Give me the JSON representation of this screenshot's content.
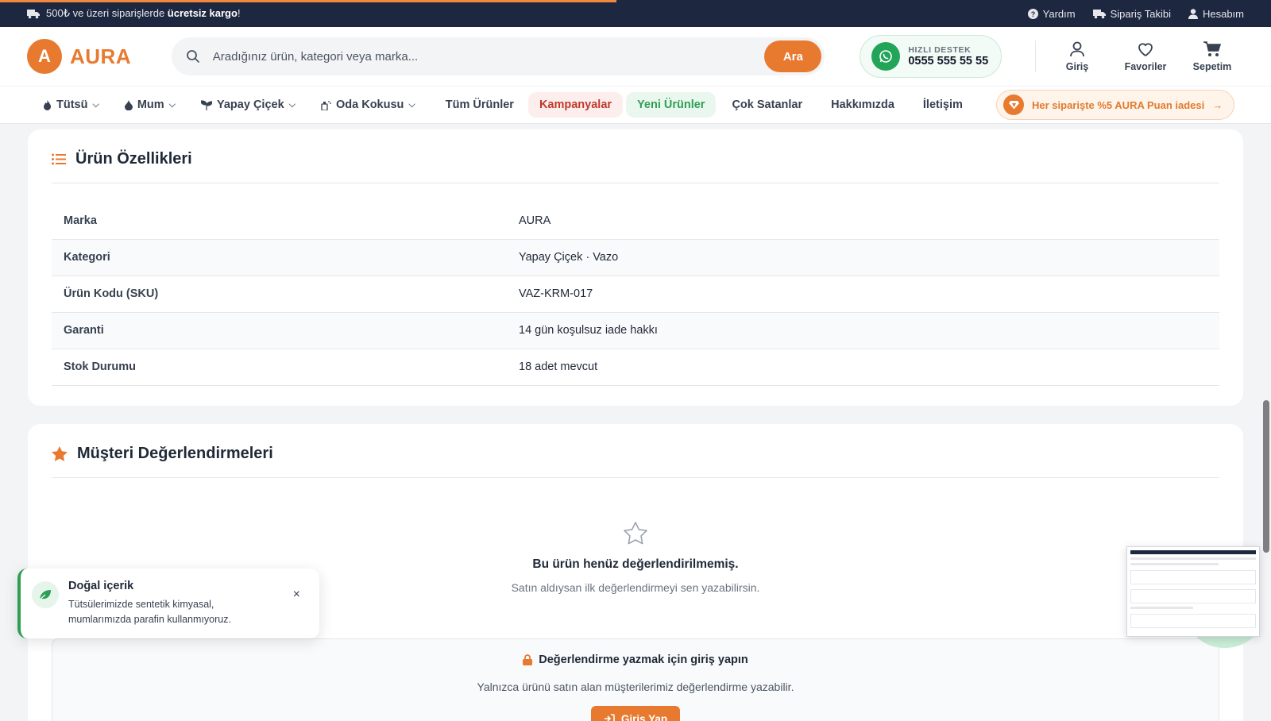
{
  "topbar": {
    "promo_prefix": "500₺ ve üzeri siparişlerde ",
    "promo_bold": "ücretsiz kargo",
    "promo_suffix": "!",
    "help": "Yardım",
    "order_tracking": "Sipariş Takibi",
    "account": "Hesabım"
  },
  "header": {
    "logo_letter": "A",
    "logo_text": "AURA",
    "search_placeholder": "Aradığınız ürün, kategori veya marka...",
    "search_button": "Ara",
    "support_label": "HIZLI DESTEK",
    "support_phone": "0555 555 55 55",
    "actions": [
      "Giriş",
      "Favoriler",
      "Sepetim"
    ]
  },
  "nav": {
    "items": [
      "Tütsü",
      "Mum",
      "Yapay Çiçek",
      "Oda Kokusu",
      "Tüm Ürünler",
      "Kampanyalar",
      "Yeni Ürünler",
      "Çok Satanlar",
      "Hakkımızda",
      "İletişim"
    ],
    "promo": "Her siparişte %5 AURA Puan iadesi"
  },
  "specs": {
    "title": "Ürün Özellikleri",
    "rows": [
      {
        "key": "Marka",
        "value": "AURA"
      },
      {
        "key": "Kategori",
        "value": "Yapay Çiçek · Vazo"
      },
      {
        "key": "Ürün Kodu (SKU)",
        "value": "VAZ-KRM-017"
      },
      {
        "key": "Garanti",
        "value": "14 gün koşulsuz iade hakkı"
      },
      {
        "key": "Stok Durumu",
        "value": "18 adet mevcut"
      }
    ]
  },
  "reviews": {
    "title": "Müşteri Değerlendirmeleri",
    "empty_title": "Bu ürün henüz değerlendirilmemiş.",
    "empty_sub": "Satın aldıysan ilk değerlendirmeyi sen yazabilirsin.",
    "login_title": "Değerlendirme yazmak için giriş yapın",
    "login_sub": "Yalnızca ürünü satın alan müşterilerimiz değerlendirme yazabilir.",
    "login_button": "Giriş Yap"
  },
  "toast": {
    "title": "Doğal içerik",
    "desc": "Tütsülerimizde sentetik kimyasal, mumlarımızda parafin kullanmıyoruz.",
    "close": "×"
  },
  "colors": {
    "accent": "#e87a30",
    "dark": "#1e2740",
    "green": "#2f9e55",
    "red": "#c0392b"
  }
}
